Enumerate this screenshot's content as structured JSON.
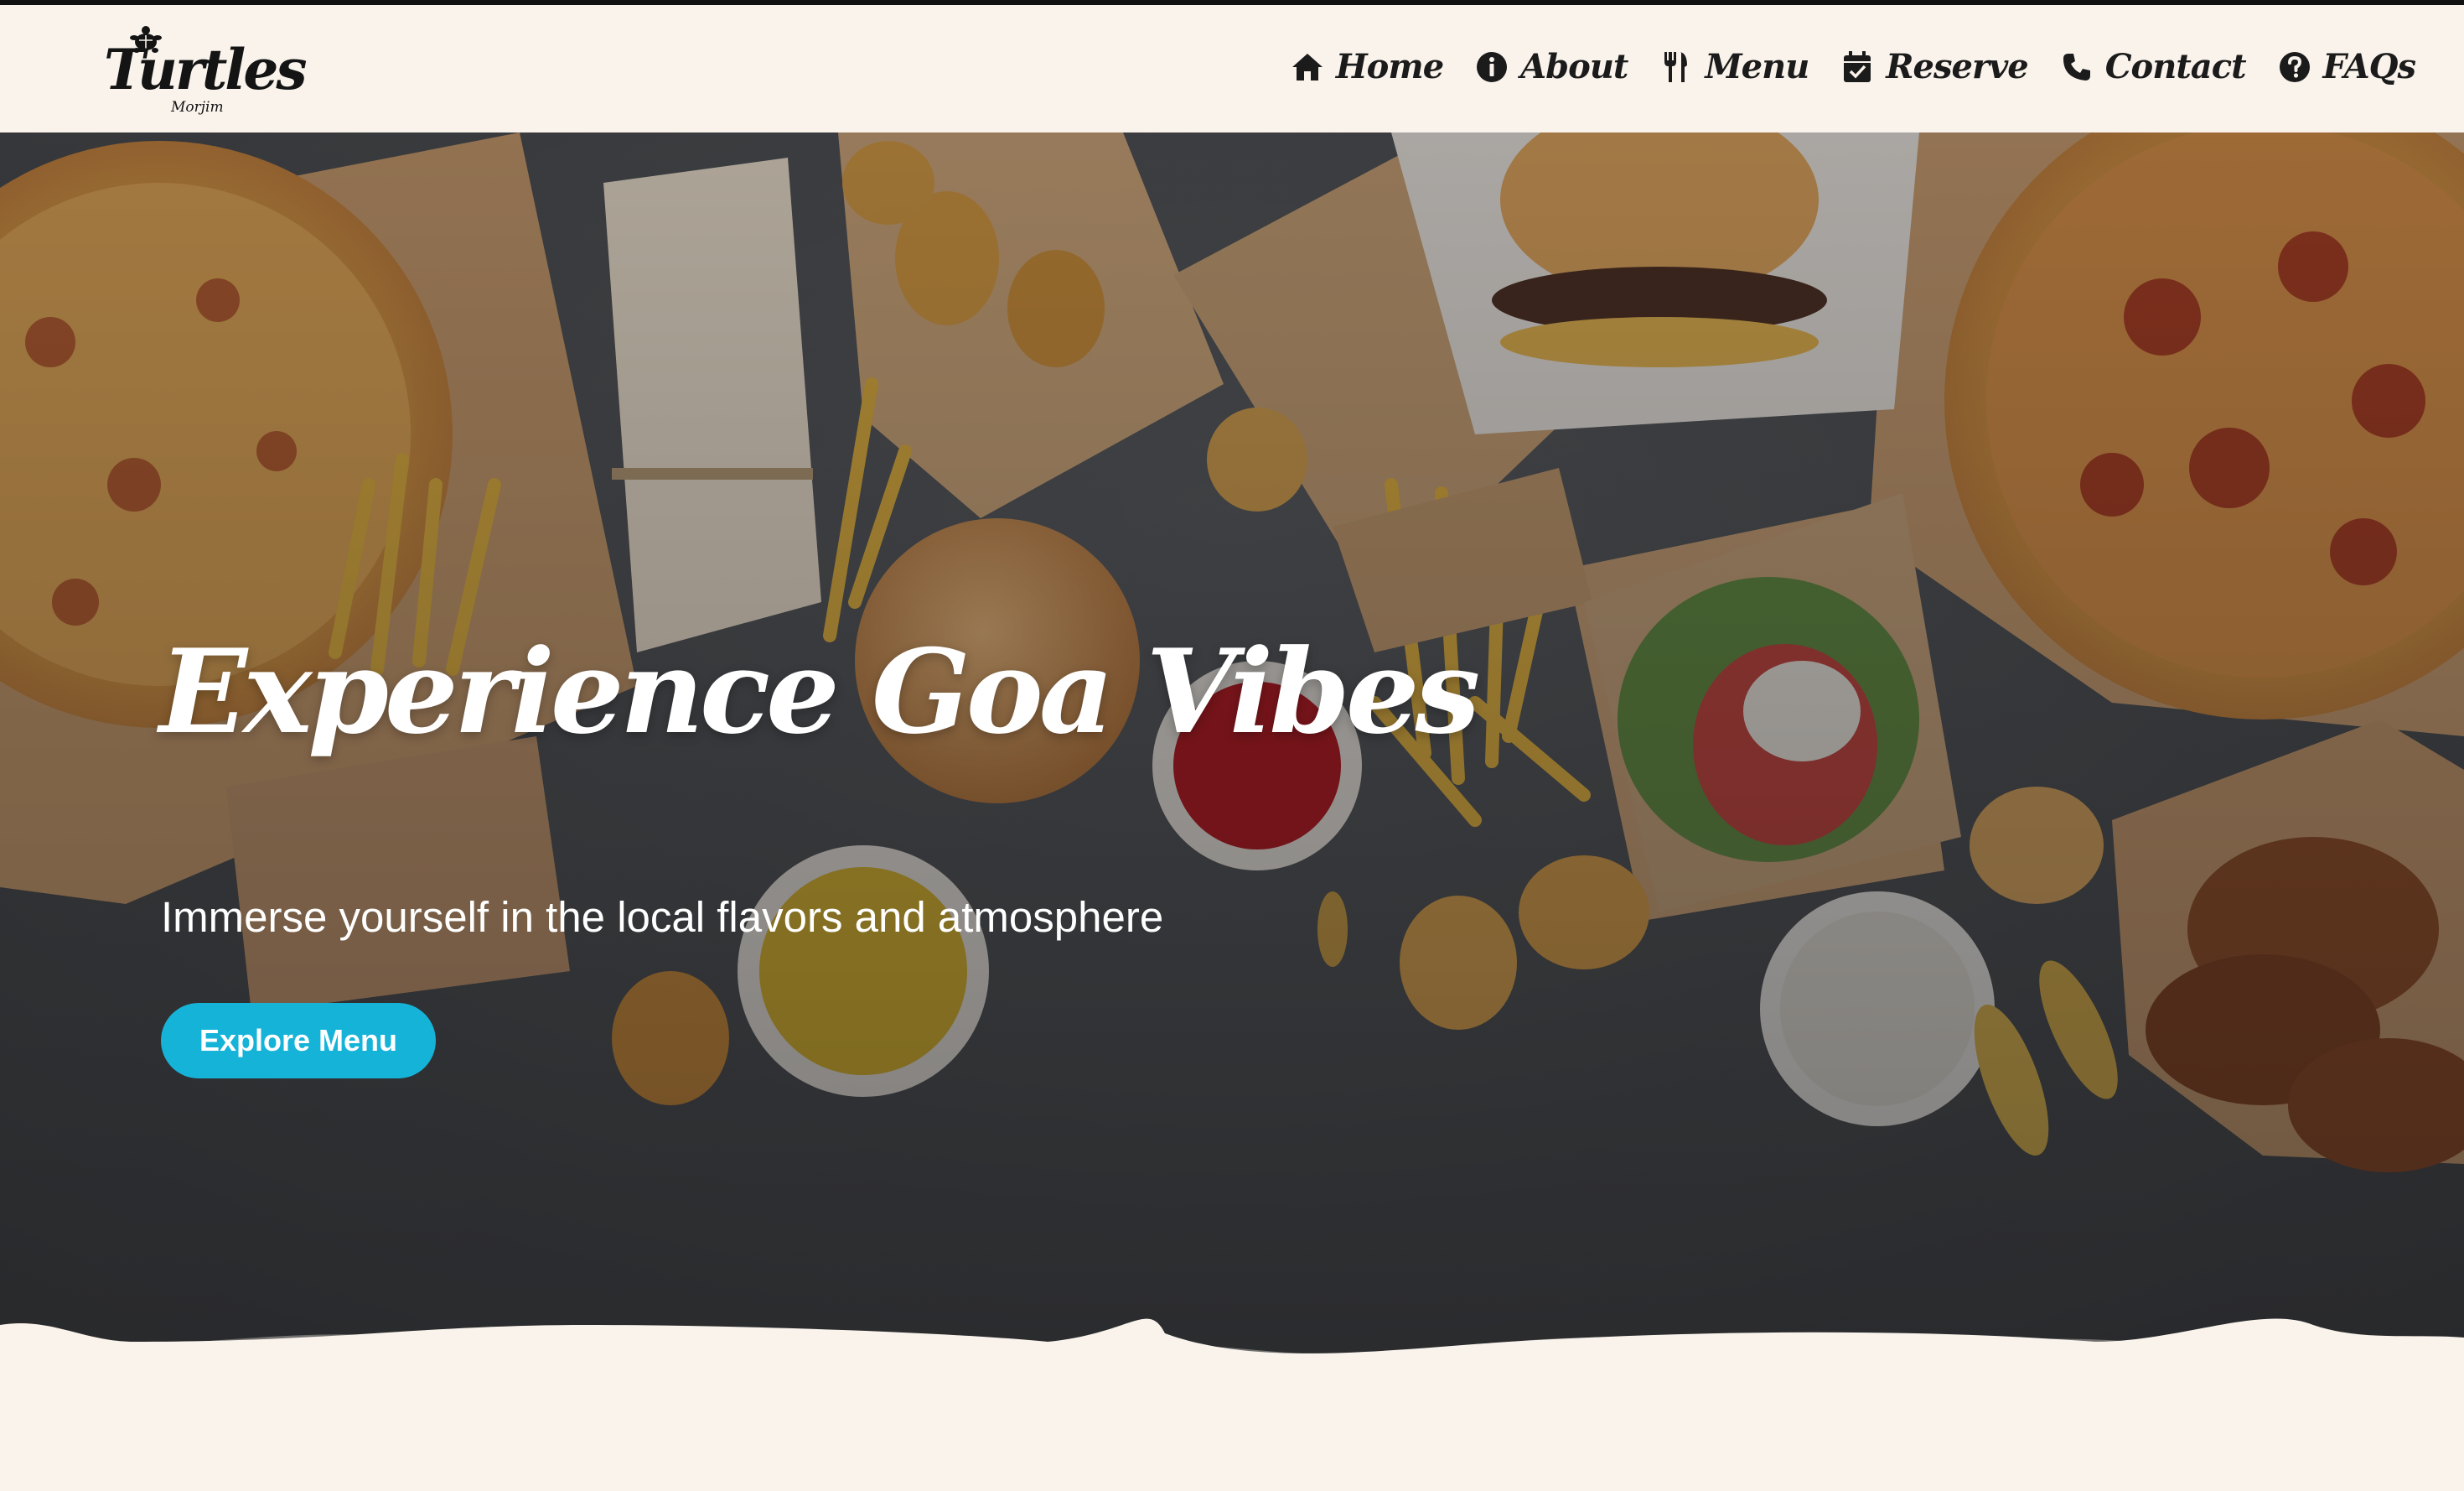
{
  "brand": {
    "logo_word": "Turtles",
    "logo_sub": "Morjim",
    "logo_icon": "turtle-icon"
  },
  "nav": {
    "items": [
      {
        "label": "Home",
        "icon": "home-icon"
      },
      {
        "label": "About",
        "icon": "info-icon"
      },
      {
        "label": "Menu",
        "icon": "utensils-icon"
      },
      {
        "label": "Reserve",
        "icon": "calendar-check-icon"
      },
      {
        "label": "Contact",
        "icon": "phone-icon"
      },
      {
        "label": "FAQs",
        "icon": "question-circle-icon"
      }
    ]
  },
  "hero": {
    "title": "Experience Goa Vibes",
    "subtitle": "Immerse yourself in the local flavors and atmosphere",
    "cta_label": "Explore Menu"
  },
  "colors": {
    "page_bg": "#faf3ec",
    "accent": "#16b3d9",
    "nav_text": "#1b1b1b"
  }
}
